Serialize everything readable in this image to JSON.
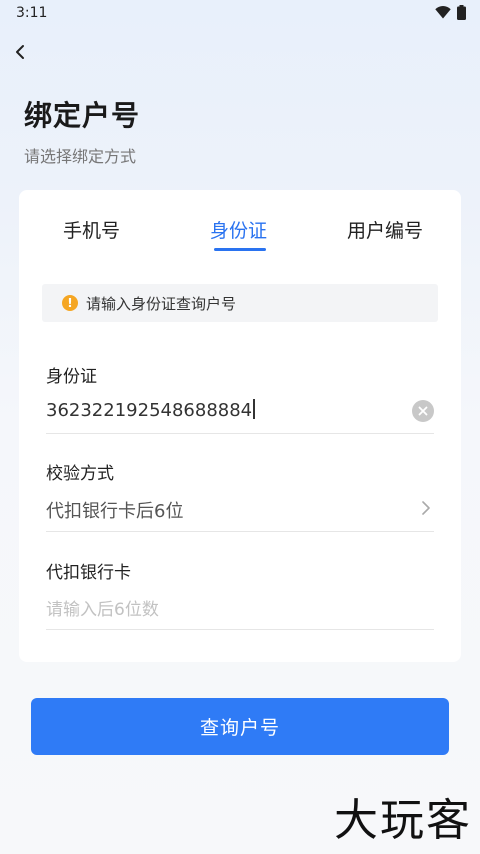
{
  "status_bar": {
    "time": "3:11"
  },
  "header": {
    "title": "绑定户号",
    "subtitle": "请选择绑定方式"
  },
  "tabs": [
    {
      "label": "手机号",
      "active": false
    },
    {
      "label": "身份证",
      "active": true
    },
    {
      "label": "用户编号",
      "active": false
    }
  ],
  "notice": {
    "text": "请输入身份证查询户号",
    "icon": "!"
  },
  "fields": {
    "id_card": {
      "label": "身份证",
      "value": "362322192548688884"
    },
    "verify_method": {
      "label": "校验方式",
      "value": "代扣银行卡后6位"
    },
    "bank_card": {
      "label": "代扣银行卡",
      "placeholder": "请输入后6位数"
    }
  },
  "submit": {
    "label": "查询户号"
  },
  "watermark": "大玩客",
  "colors": {
    "accent": "#2a73f0",
    "button": "#2f7bf6",
    "warning": "#f5a623"
  }
}
